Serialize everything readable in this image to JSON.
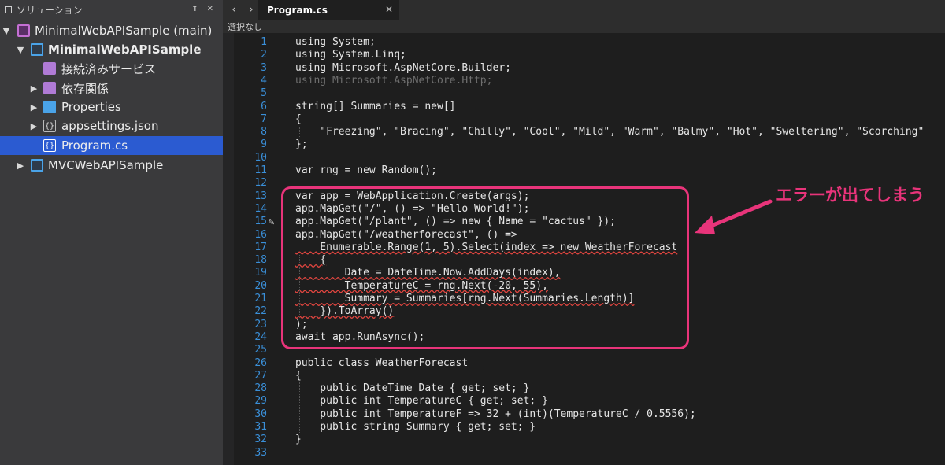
{
  "sidebar": {
    "title": "ソリューション",
    "controls": "⬆ ✕",
    "items": [
      {
        "label": "MinimalWebAPISample (main)",
        "arrow": "▼",
        "icon": "solution-icon"
      },
      {
        "label": "MinimalWebAPISample",
        "arrow": "▼",
        "icon": "project-icon"
      },
      {
        "label": "接続済みサービス",
        "arrow": "",
        "icon": "connected-services-icon"
      },
      {
        "label": "依存関係",
        "arrow": "▶",
        "icon": "dependencies-icon"
      },
      {
        "label": "Properties",
        "arrow": "▶",
        "icon": "folder-icon"
      },
      {
        "label": "appsettings.json",
        "arrow": "▶",
        "icon": "json-file-icon",
        "glyph": "{}"
      },
      {
        "label": "Program.cs",
        "arrow": "",
        "icon": "csharp-file-icon",
        "glyph": "{}"
      },
      {
        "label": "MVCWebAPISample",
        "arrow": "▶",
        "icon": "project-icon"
      }
    ]
  },
  "editor": {
    "nav_back": "‹",
    "nav_forward": "›",
    "tab_label": "Program.cs",
    "tab_close": "✕",
    "breadcrumb": "選択なし",
    "line_numbers": [
      "1",
      "2",
      "3",
      "4",
      "5",
      "6",
      "7",
      "8",
      "9",
      "10",
      "11",
      "12",
      "13",
      "14",
      "15",
      "16",
      "17",
      "18",
      "19",
      "20",
      "21",
      "22",
      "23",
      "24",
      "25",
      "26",
      "27",
      "28",
      "29",
      "30",
      "31",
      "32",
      "33"
    ],
    "code_lines": [
      "using System;",
      "using System.Linq;",
      "using Microsoft.AspNetCore.Builder;",
      "using Microsoft.AspNetCore.Http;",
      "",
      "string[] Summaries = new[]",
      "{",
      "    \"Freezing\", \"Bracing\", \"Chilly\", \"Cool\", \"Mild\", \"Warm\", \"Balmy\", \"Hot\", \"Sweltering\", \"Scorching\"",
      "};",
      "",
      "var rng = new Random();",
      "",
      "var app = WebApplication.Create(args);",
      "app.MapGet(\"/\", () => \"Hello World!\");",
      "app.MapGet(\"/plant\", () => new { Name = \"cactus\" });",
      "app.MapGet(\"/weatherforecast\", () =>",
      "    Enumerable.Range(1, 5).Select(index => new WeatherForecast",
      "    {",
      "        Date = DateTime.Now.AddDays(index),",
      "        TemperatureC = rng.Next(-20, 55),",
      "        Summary = Summaries[rng.Next(Summaries.Length)]",
      "    }).ToArray()",
      ");",
      "await app.RunAsync();",
      "",
      "public class WeatherForecast",
      "{",
      "    public DateTime Date { get; set; }",
      "    public int TemperatureC { get; set; }",
      "    public int TemperatureF => 32 + (int)(TemperatureC / 0.5556);",
      "    public string Summary { get; set; }",
      "}",
      ""
    ]
  },
  "annotation": {
    "text": "エラーが出てしまう",
    "color": "#e8347a"
  },
  "colors": {
    "selection": "#2b5bd1",
    "keyword": "#5aa0e6",
    "type": "#4ec9b0",
    "string": "#e8c88a",
    "error_squiggle": "#e0453f"
  }
}
